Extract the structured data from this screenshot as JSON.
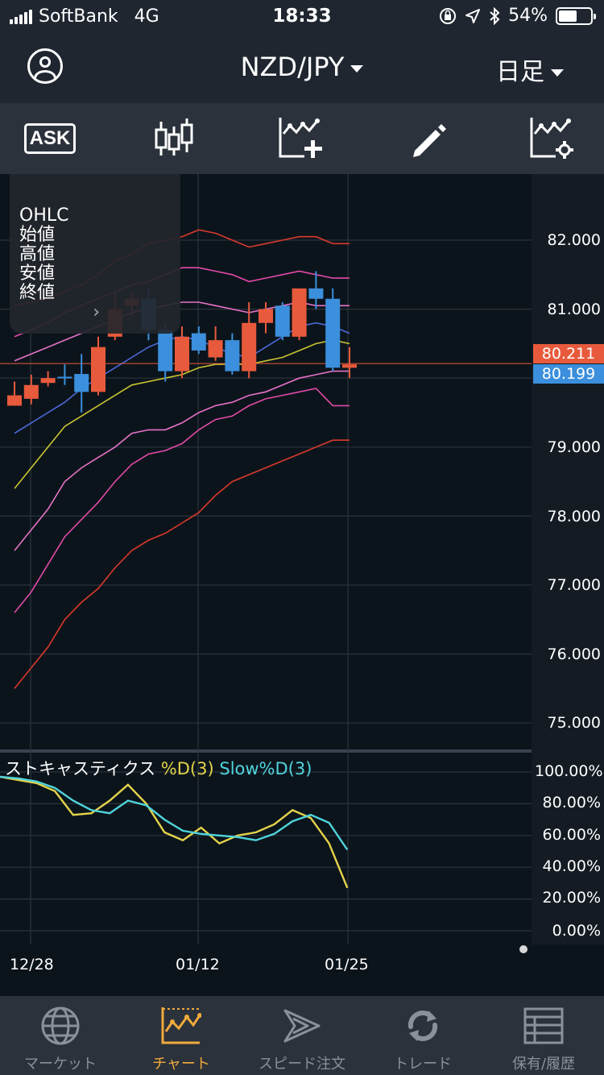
{
  "status_bar": {
    "carrier": "SoftBank",
    "network": "4G",
    "time": "18:33",
    "battery": "54%"
  },
  "header": {
    "symbol": "NZD/JPY",
    "period": "日足"
  },
  "toolbar": {
    "ask_label": "ASK"
  },
  "ohlc_panel": {
    "title": "OHLC",
    "open": "始値",
    "high": "高値",
    "low": "安値",
    "close": "終値"
  },
  "price_axis": {
    "labels": [
      "82.000",
      "81.000",
      "79.000",
      "78.000",
      "77.000",
      "76.000",
      "75.000"
    ]
  },
  "price_tags": {
    "ask": "80.211",
    "bid": "80.199"
  },
  "stoch": {
    "title": "ストキャスティクス",
    "d_label": "%D(3)",
    "slow_label": "Slow%D(3)",
    "axis_labels": [
      "100.00%",
      "80.00%",
      "60.00%",
      "40.00%",
      "20.00%",
      "0.00%"
    ]
  },
  "x_axis": {
    "labels": [
      "12/28",
      "01/12",
      "01/25"
    ]
  },
  "nav": {
    "items": [
      {
        "label": "マーケット"
      },
      {
        "label": "チャート"
      },
      {
        "label": "スピード注文"
      },
      {
        "label": "トレード"
      },
      {
        "label": "保有/履歴"
      }
    ]
  },
  "colors": {
    "up_candle": "#e85a3c",
    "down_candle": "#3b8fdc",
    "ask_tag": "#e85a3c",
    "bid_tag": "#3b8fdc",
    "stoch_d": "#e3d34b",
    "stoch_slow": "#4fd4dc",
    "active_nav": "#f0a93a"
  },
  "chart_data": [
    {
      "type": "candlestick",
      "ylim": [
        74.6,
        83.0
      ],
      "candles": [
        {
          "o": 79.75,
          "h": 79.95,
          "l": 79.6,
          "c": 79.6,
          "dir": "up"
        },
        {
          "o": 79.7,
          "h": 80.05,
          "l": 79.62,
          "c": 79.9,
          "dir": "up"
        },
        {
          "o": 79.93,
          "h": 80.1,
          "l": 79.88,
          "c": 80.0,
          "dir": "up"
        },
        {
          "o": 80.02,
          "h": 80.2,
          "l": 79.9,
          "c": 80.0,
          "dir": "down"
        },
        {
          "o": 80.06,
          "h": 80.35,
          "l": 79.5,
          "c": 79.8,
          "dir": "down"
        },
        {
          "o": 79.8,
          "h": 80.6,
          "l": 79.75,
          "c": 80.45,
          "dir": "up"
        },
        {
          "o": 80.6,
          "h": 81.25,
          "l": 80.55,
          "c": 81.0,
          "dir": "up"
        },
        {
          "o": 81.05,
          "h": 81.25,
          "l": 80.9,
          "c": 81.15,
          "dir": "up"
        },
        {
          "o": 81.15,
          "h": 81.3,
          "l": 80.55,
          "c": 80.7,
          "dir": "down"
        },
        {
          "o": 80.7,
          "h": 80.8,
          "l": 79.95,
          "c": 80.1,
          "dir": "down"
        },
        {
          "o": 80.1,
          "h": 80.75,
          "l": 80.0,
          "c": 80.6,
          "dir": "up"
        },
        {
          "o": 80.65,
          "h": 80.75,
          "l": 80.35,
          "c": 80.4,
          "dir": "down"
        },
        {
          "o": 80.3,
          "h": 80.75,
          "l": 80.25,
          "c": 80.55,
          "dir": "up"
        },
        {
          "o": 80.55,
          "h": 80.65,
          "l": 80.05,
          "c": 80.1,
          "dir": "down"
        },
        {
          "o": 80.1,
          "h": 81.1,
          "l": 80.0,
          "c": 80.8,
          "dir": "up"
        },
        {
          "o": 80.8,
          "h": 81.1,
          "l": 80.65,
          "c": 81.0,
          "dir": "up"
        },
        {
          "o": 81.05,
          "h": 81.1,
          "l": 80.55,
          "c": 80.6,
          "dir": "down"
        },
        {
          "o": 80.6,
          "h": 81.3,
          "l": 80.55,
          "c": 81.3,
          "dir": "up"
        },
        {
          "o": 81.3,
          "h": 81.55,
          "l": 81.0,
          "c": 81.15,
          "dir": "down"
        },
        {
          "o": 81.15,
          "h": 81.3,
          "l": 80.1,
          "c": 80.15,
          "dir": "down"
        },
        {
          "o": 80.15,
          "h": 80.45,
          "l": 80.0,
          "c": 80.2,
          "dir": "up"
        }
      ],
      "bands": [
        {
          "name": "upper3",
          "color": "#d8392c",
          "values": [
            81.05,
            81.1,
            81.15,
            81.25,
            81.35,
            81.5,
            81.7,
            81.8,
            81.95,
            82.0,
            82.05,
            82.15,
            82.1,
            82.0,
            81.9,
            81.95,
            82.0,
            82.05,
            82.05,
            81.95,
            81.95
          ]
        },
        {
          "name": "upper2",
          "color": "#e24aa8",
          "values": [
            80.6,
            80.7,
            80.8,
            80.95,
            81.05,
            81.15,
            81.25,
            81.35,
            81.4,
            81.5,
            81.6,
            81.6,
            81.55,
            81.5,
            81.4,
            81.45,
            81.5,
            81.55,
            81.5,
            81.45,
            81.45
          ]
        },
        {
          "name": "upper1",
          "color": "#e572c8",
          "values": [
            80.25,
            80.35,
            80.45,
            80.55,
            80.65,
            80.75,
            80.85,
            80.95,
            81.0,
            81.05,
            81.1,
            81.1,
            81.05,
            81.0,
            80.95,
            81.0,
            81.05,
            81.1,
            81.05,
            81.05,
            81.05
          ]
        },
        {
          "name": "mid",
          "color": "#4a6ad8",
          "values": [
            79.2,
            79.35,
            79.5,
            79.65,
            79.85,
            80.0,
            80.15,
            80.3,
            80.45,
            80.55,
            80.6,
            80.55,
            80.45,
            80.35,
            80.3,
            80.45,
            80.6,
            80.75,
            80.8,
            80.75,
            80.65
          ]
        },
        {
          "name": "lower1",
          "color": "#c9c431",
          "values": [
            78.4,
            78.7,
            79.0,
            79.3,
            79.45,
            79.6,
            79.75,
            79.9,
            79.95,
            80.0,
            80.05,
            80.15,
            80.2,
            80.2,
            80.2,
            80.25,
            80.3,
            80.4,
            80.5,
            80.55,
            80.5
          ]
        },
        {
          "name": "lower2",
          "color": "#e572c8",
          "values": [
            77.5,
            77.8,
            78.1,
            78.5,
            78.7,
            78.85,
            79.0,
            79.2,
            79.25,
            79.25,
            79.35,
            79.5,
            79.6,
            79.65,
            79.75,
            79.8,
            79.9,
            80.0,
            80.05,
            80.1,
            80.1
          ]
        },
        {
          "name": "lower3",
          "color": "#e24aa8",
          "values": [
            76.6,
            76.9,
            77.3,
            77.7,
            77.95,
            78.2,
            78.5,
            78.75,
            78.9,
            78.95,
            79.05,
            79.25,
            79.4,
            79.45,
            79.6,
            79.7,
            79.75,
            79.8,
            79.85,
            79.6,
            79.6
          ]
        },
        {
          "name": "lower4",
          "color": "#d8392c",
          "values": [
            75.5,
            75.8,
            76.1,
            76.5,
            76.75,
            76.95,
            77.25,
            77.5,
            77.65,
            77.75,
            77.9,
            78.05,
            78.3,
            78.5,
            78.6,
            78.7,
            78.8,
            78.9,
            79.0,
            79.1,
            79.1
          ]
        }
      ]
    },
    {
      "type": "line",
      "ylim": [
        0,
        100
      ],
      "series": [
        {
          "name": "%D(3)",
          "values": [
            97,
            95,
            93,
            88,
            73,
            74,
            82,
            92,
            80,
            62,
            57,
            65,
            55,
            60,
            62,
            67,
            76,
            71,
            55,
            27
          ]
        },
        {
          "name": "Slow%D(3)",
          "values": [
            97,
            96,
            94,
            90,
            82,
            76,
            74,
            82,
            79,
            70,
            63,
            61,
            60,
            59,
            57,
            61,
            69,
            73,
            68,
            51
          ]
        }
      ]
    }
  ]
}
